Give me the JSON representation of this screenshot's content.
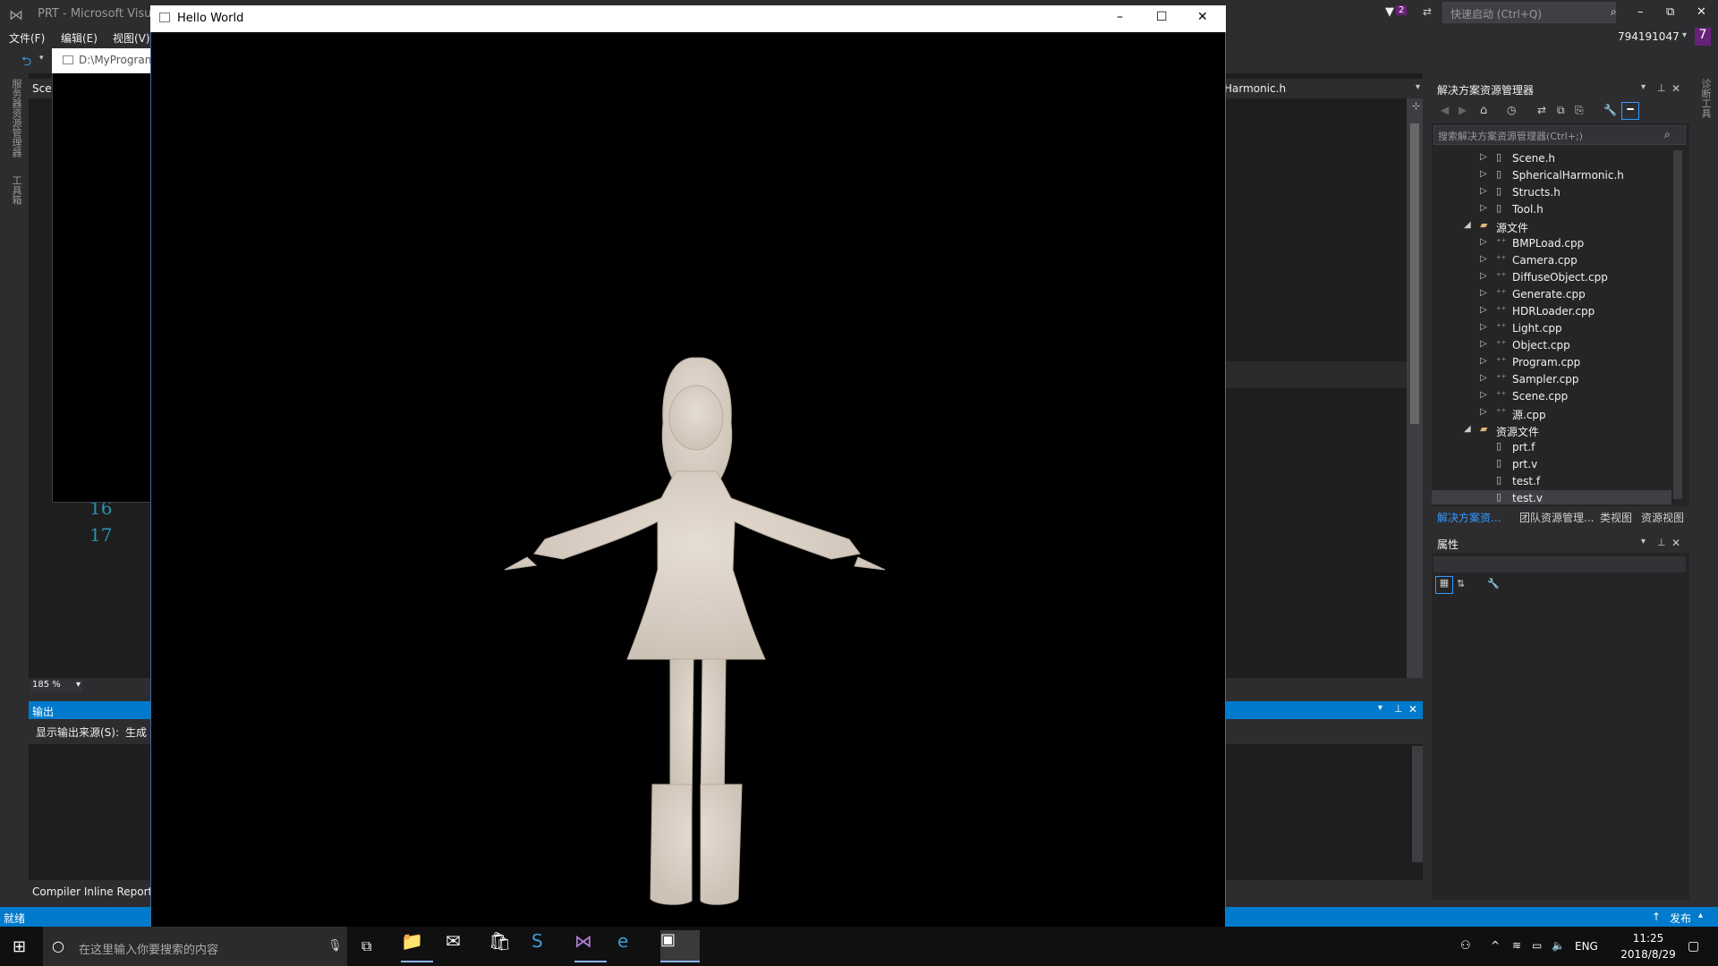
{
  "vs": {
    "title": "PRT - Microsoft Visu",
    "quick_launch": "快速启动 (Ctrl+Q)",
    "account": "794191047",
    "badge": "7",
    "notif_count": "2",
    "menu": [
      "文件(F)",
      "编辑(E)",
      "视图(V)"
    ],
    "nav_path": "D:\\MyProgran",
    "editor_tab_left": "Scer",
    "editor_tab_right": "Harmonic.h",
    "line_numbers": [
      "16",
      "17"
    ],
    "zoom": "185 %",
    "left_side_labels": [
      "服务器资源管理器",
      "工具箱"
    ],
    "right_side_label": "诊断工具"
  },
  "output": {
    "title": "输出",
    "source_label": "显示输出来源(S):",
    "source_value": "生成",
    "bottom_tab": "Compiler Inline Report"
  },
  "status": {
    "ready": "就绪",
    "publish": "发布"
  },
  "solution_explorer": {
    "title": "解决方案资源管理器",
    "search_placeholder": "搜索解决方案资源管理器(Ctrl+;)",
    "headers_files": [
      "Scene.h",
      "SphericalHarmonic.h",
      "Structs.h",
      "Tool.h"
    ],
    "source_folder": "源文件",
    "source_files": [
      "BMPLoad.cpp",
      "Camera.cpp",
      "DiffuseObject.cpp",
      "Generate.cpp",
      "HDRLoader.cpp",
      "Light.cpp",
      "Object.cpp",
      "Program.cpp",
      "Sampler.cpp",
      "Scene.cpp",
      "源.cpp"
    ],
    "resource_folder": "资源文件",
    "resource_files": [
      "prt.f",
      "prt.v",
      "test.f",
      "test.v"
    ],
    "tabs": [
      "解决方案资...",
      "团队资源管理...",
      "类视图",
      "资源视图"
    ]
  },
  "properties": {
    "title": "属性"
  },
  "app_window": {
    "title": "Hello World"
  },
  "taskbar": {
    "search_placeholder": "在这里输入你要搜索的内容",
    "lang": "ENG",
    "time": "11:25",
    "date": "2018/8/29"
  },
  "colors": {
    "vs_bg": "#2d2d30",
    "accent": "#007acc",
    "figure": "#e0d6cc"
  }
}
